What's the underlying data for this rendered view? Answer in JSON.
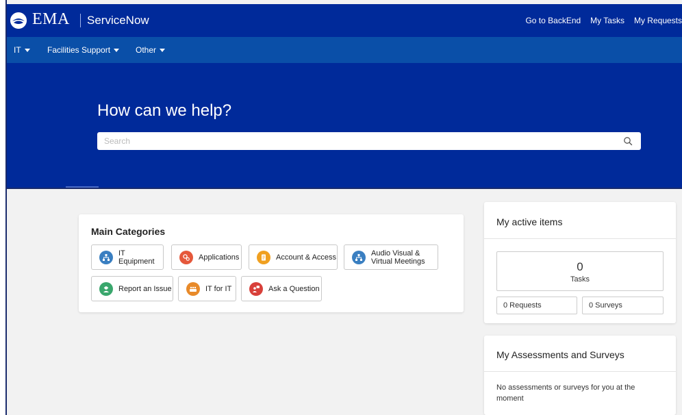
{
  "header": {
    "brand": "EMA",
    "app_name": "ServiceNow",
    "links": [
      "Go to BackEnd",
      "My Tasks",
      "My Requests"
    ]
  },
  "nav": {
    "items": [
      "IT",
      "Facilities Support",
      "Other"
    ]
  },
  "hero": {
    "title": "How can we help?",
    "search_placeholder": "Search"
  },
  "main_categories": {
    "title": "Main Categories",
    "items": [
      {
        "label": "IT Equipment",
        "icon": "network-icon",
        "color": "#3a7fc1"
      },
      {
        "label": "Applications",
        "icon": "gears-icon",
        "color": "#e5583b"
      },
      {
        "label": "Account & Access",
        "icon": "document-icon",
        "color": "#f0a020"
      },
      {
        "label_line1": "Audio Visual &",
        "label_line2": "Virtual Meetings",
        "icon": "network-icon",
        "color": "#3a7fc1"
      },
      {
        "label": "Report an Issue",
        "icon": "support-agent-icon",
        "color": "#3aa76d"
      },
      {
        "label": "IT for IT",
        "icon": "team-icon",
        "color": "#e88a2a"
      },
      {
        "label": "Ask a Question",
        "icon": "people-question-icon",
        "color": "#d8403a"
      }
    ]
  },
  "active_items": {
    "title": "My active items",
    "tasks_count": "0",
    "tasks_label": "Tasks",
    "requests": "0 Requests",
    "surveys": "0 Surveys"
  },
  "assessments": {
    "title": "My Assessments and Surveys",
    "message": "No assessments or surveys for you at the moment"
  },
  "colors": {
    "header_bg": "#002a9a",
    "nav_bg": "#0a4fa8",
    "page_bg": "#f2f2f2"
  }
}
